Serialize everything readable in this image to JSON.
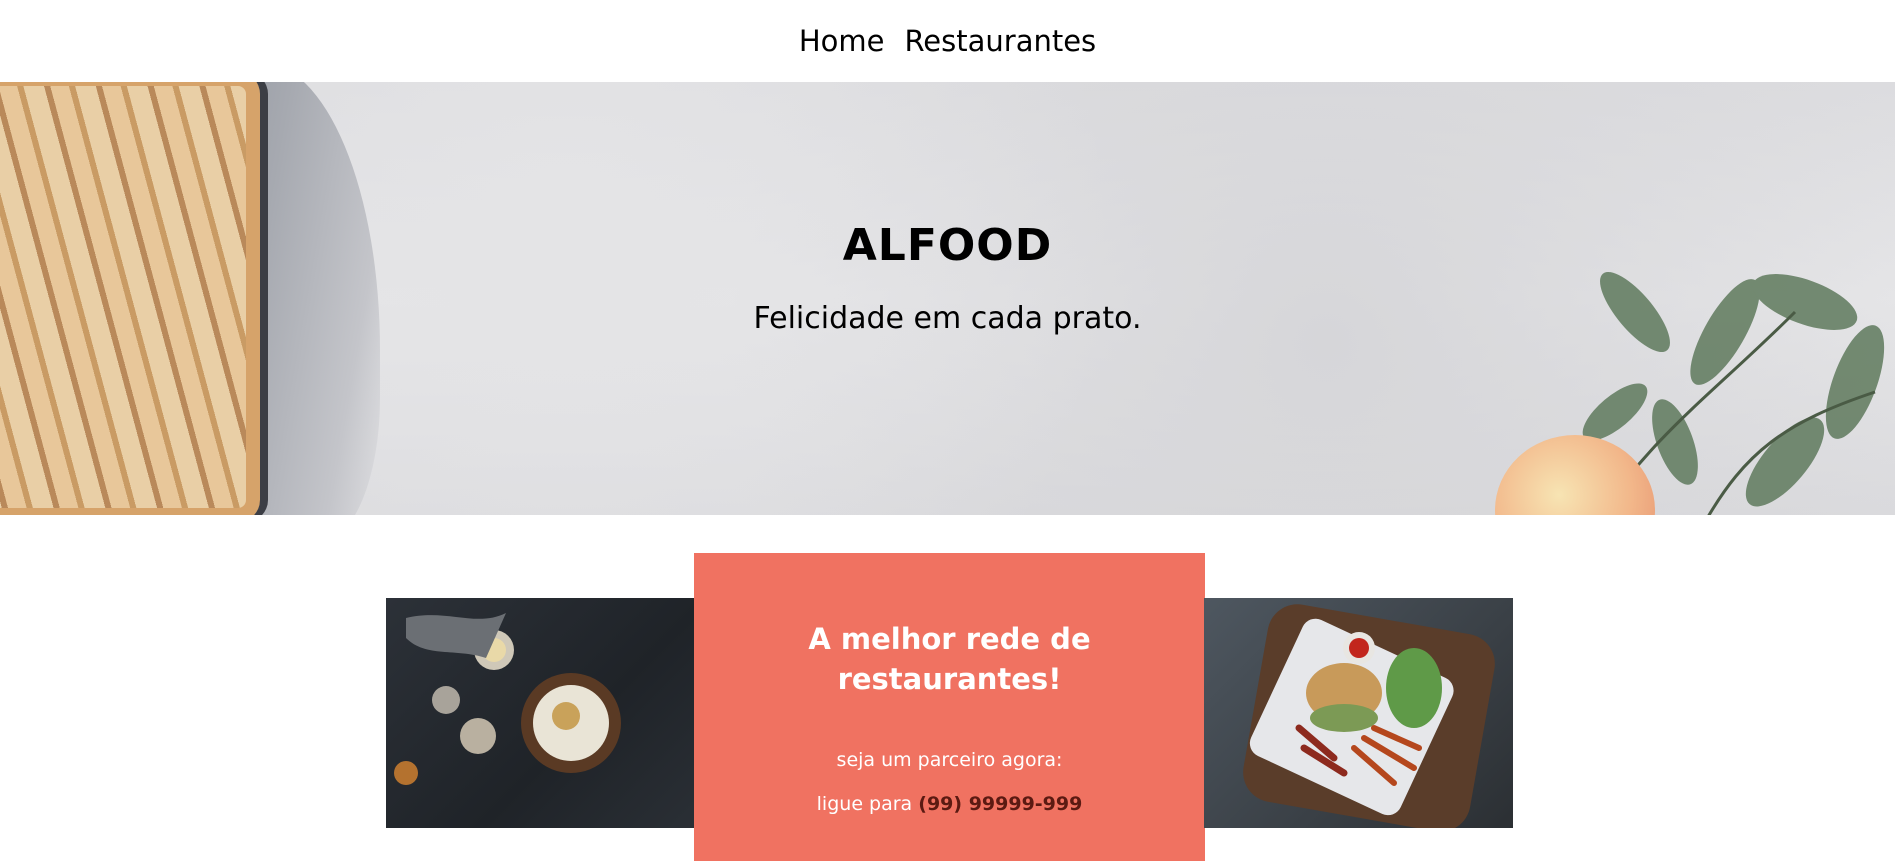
{
  "nav": {
    "items": [
      {
        "label": "Home"
      },
      {
        "label": "Restaurantes"
      }
    ]
  },
  "hero": {
    "title": "ALFOOD",
    "subtitle": "Felicidade em cada prato."
  },
  "promo": {
    "heading": "A melhor rede de restaurantes!",
    "partner_text": "seja um parceiro agora:",
    "call_prefix": "ligue para",
    "phone": "(99) 99999-999"
  },
  "colors": {
    "accent": "#f07261",
    "phone": "#5b1a12"
  }
}
